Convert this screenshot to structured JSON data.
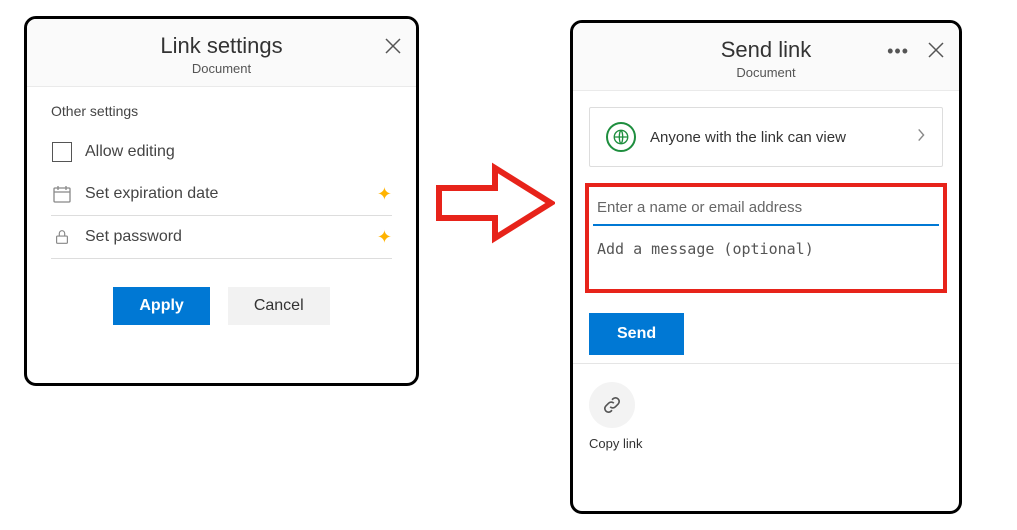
{
  "left": {
    "title": "Link settings",
    "subtitle": "Document",
    "section": "Other settings",
    "allow_editing": "Allow editing",
    "expiration": "Set expiration date",
    "password": "Set password",
    "apply": "Apply",
    "cancel": "Cancel"
  },
  "right": {
    "title": "Send link",
    "subtitle": "Document",
    "scope": "Anyone with the link can view",
    "name_placeholder": "Enter a name or email address",
    "message_placeholder": "Add a message (optional)",
    "send": "Send",
    "copy_link": "Copy link"
  }
}
